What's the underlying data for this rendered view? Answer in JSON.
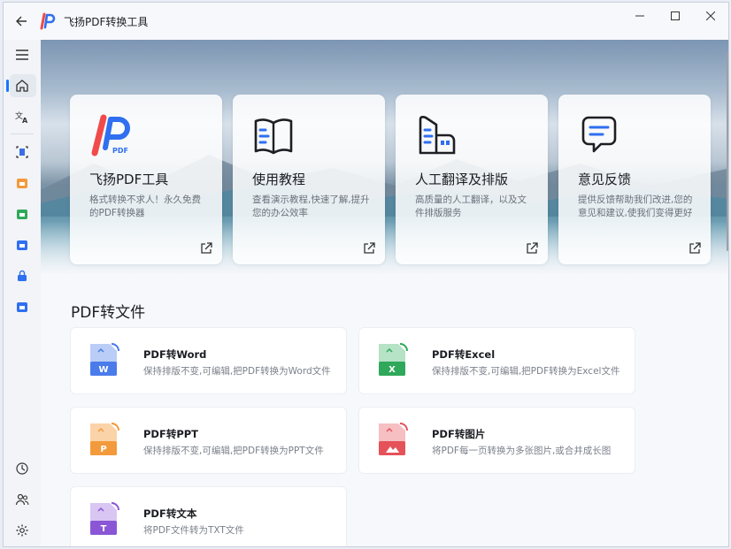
{
  "window": {
    "title": "飞扬PDF转换工具"
  },
  "colors": {
    "accent": "#1677ff",
    "word": "#4a7bea",
    "excel": "#2fa85a",
    "ppt": "#f39a3c",
    "image": "#e5525a",
    "text": "#8a56d6",
    "brand_red": "#f04a4a",
    "brand_blue": "#2f6ff0"
  },
  "sidebar": {
    "top": [
      {
        "name": "menu-icon"
      },
      {
        "name": "home-icon",
        "active": true
      },
      {
        "name": "translate-icon"
      }
    ],
    "tools": [
      {
        "name": "scan-icon"
      },
      {
        "name": "orange-folder-icon"
      },
      {
        "name": "green-folder-icon"
      },
      {
        "name": "blue-folder-icon"
      },
      {
        "name": "lock-folder-icon"
      },
      {
        "name": "blue-folder-2-icon"
      }
    ],
    "bottom": [
      {
        "name": "history-icon"
      },
      {
        "name": "users-icon"
      },
      {
        "name": "settings-icon"
      }
    ]
  },
  "cards": [
    {
      "title": "飞扬PDF工具",
      "desc": "格式转换不求人！永久免费的PDF转换器",
      "icon": "brand-logo-icon"
    },
    {
      "title": "使用教程",
      "desc": "查看演示教程,快速了解,提升您的办公效率",
      "icon": "book-icon"
    },
    {
      "title": "人工翻译及排版",
      "desc": "高质量的人工翻译，以及文件排版服务",
      "icon": "translation-service-icon"
    },
    {
      "title": "意见反馈",
      "desc": "提供反馈帮助我们改进,您的意见和建议,使我们变得更好",
      "icon": "feedback-icon"
    }
  ],
  "section": {
    "title": "PDF转文件"
  },
  "tools": [
    {
      "name": "PDF转Word",
      "desc": "保持排版不变,可编辑,把PDF转换为Word文件",
      "letter": "W",
      "color": "#4a7bea"
    },
    {
      "name": "PDF转Excel",
      "desc": "保持排版不变,可编辑,把PDF转换为Excel文件",
      "letter": "X",
      "color": "#2fa85a"
    },
    {
      "name": "PDF转PPT",
      "desc": "保持排版不变,可编辑,把PDF转换为PPT文件",
      "letter": "P",
      "color": "#f39a3c"
    },
    {
      "name": "PDF转图片",
      "desc": "将PDF每一页转换为多张图片,或合并成长图",
      "letter": "",
      "color": "#e5525a"
    },
    {
      "name": "PDF转文本",
      "desc": "将PDF文件转为TXT文件",
      "letter": "T",
      "color": "#8a56d6"
    }
  ]
}
